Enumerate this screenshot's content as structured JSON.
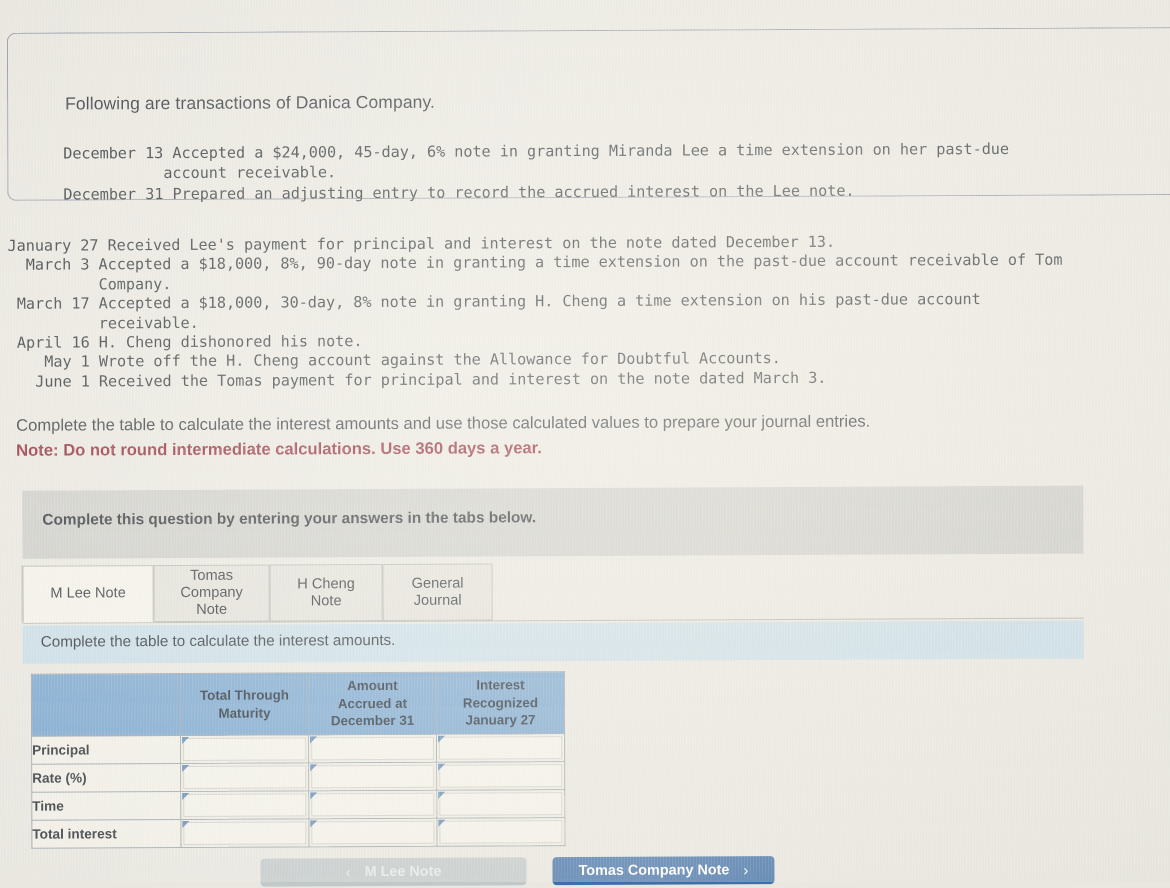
{
  "intro": {
    "title": "Following are transactions of Danica Company.",
    "transactions": "December 13 Accepted a $24,000, 45-day, 6% note in granting Miranda Lee a time extension on her past-due\n           account receivable.\nDecember 31 Prepared an adjusting entry to record the accrued interest on the Lee note."
  },
  "second_block": {
    "transactions": "January 27 Received Lee's payment for principal and interest on the note dated December 13.\n  March 3 Accepted a $18,000, 8%, 90-day note in granting a time extension on the past-due account receivable of Tom\n          Company.\n March 17 Accepted a $18,000, 30-day, 8% note in granting H. Cheng a time extension on his past-due account\n          receivable.\n April 16 H. Cheng dishonored his note.\n    May 1 Wrote off the H. Cheng account against the Allowance for Doubtful Accounts.\n   June 1 Received the Tomas payment for principal and interest on the note dated March 3."
  },
  "instructions": {
    "main": "Complete the table to calculate the interest amounts and use those calculated values to prepare your journal entries.",
    "note": "Note: Do not round intermediate calculations. Use 360 days a year.",
    "note_color": "#8e2433"
  },
  "grey_banner": {
    "text": "Complete this question by entering your answers in the tabs below."
  },
  "tabs": [
    {
      "label": "M Lee Note",
      "active": true
    },
    {
      "label": "Tomas\nCompany Note",
      "active": false
    },
    {
      "label": "H Cheng Note",
      "active": false
    },
    {
      "label": "General\nJournal",
      "active": false
    }
  ],
  "blue_bar": {
    "text": "Complete the table to calculate the interest amounts."
  },
  "table": {
    "accent_header_color": "#78a5cf",
    "columns": [
      "",
      "Total Through Maturity",
      "Amount Accrued at December 31",
      "Interest Recognized January 27"
    ],
    "column_lines": [
      [
        ""
      ],
      [
        "Total Through",
        "Maturity"
      ],
      [
        "Amount",
        "Accrued at",
        "December 31"
      ],
      [
        "Interest",
        "Recognized",
        "January 27"
      ]
    ],
    "rows": [
      {
        "label": "Principal",
        "values": [
          "",
          "",
          ""
        ]
      },
      {
        "label": "Rate (%)",
        "values": [
          "",
          "",
          ""
        ]
      },
      {
        "label": "Time",
        "values": [
          "",
          "",
          ""
        ]
      },
      {
        "label": "Total interest",
        "values": [
          "",
          "",
          ""
        ]
      }
    ]
  },
  "nav": {
    "prev_label": "M Lee Note",
    "prev_chevron": "‹",
    "prev_disabled": true,
    "next_label": "Tomas Company Note",
    "next_chevron": "›",
    "next_color": "#3f6fa8"
  }
}
